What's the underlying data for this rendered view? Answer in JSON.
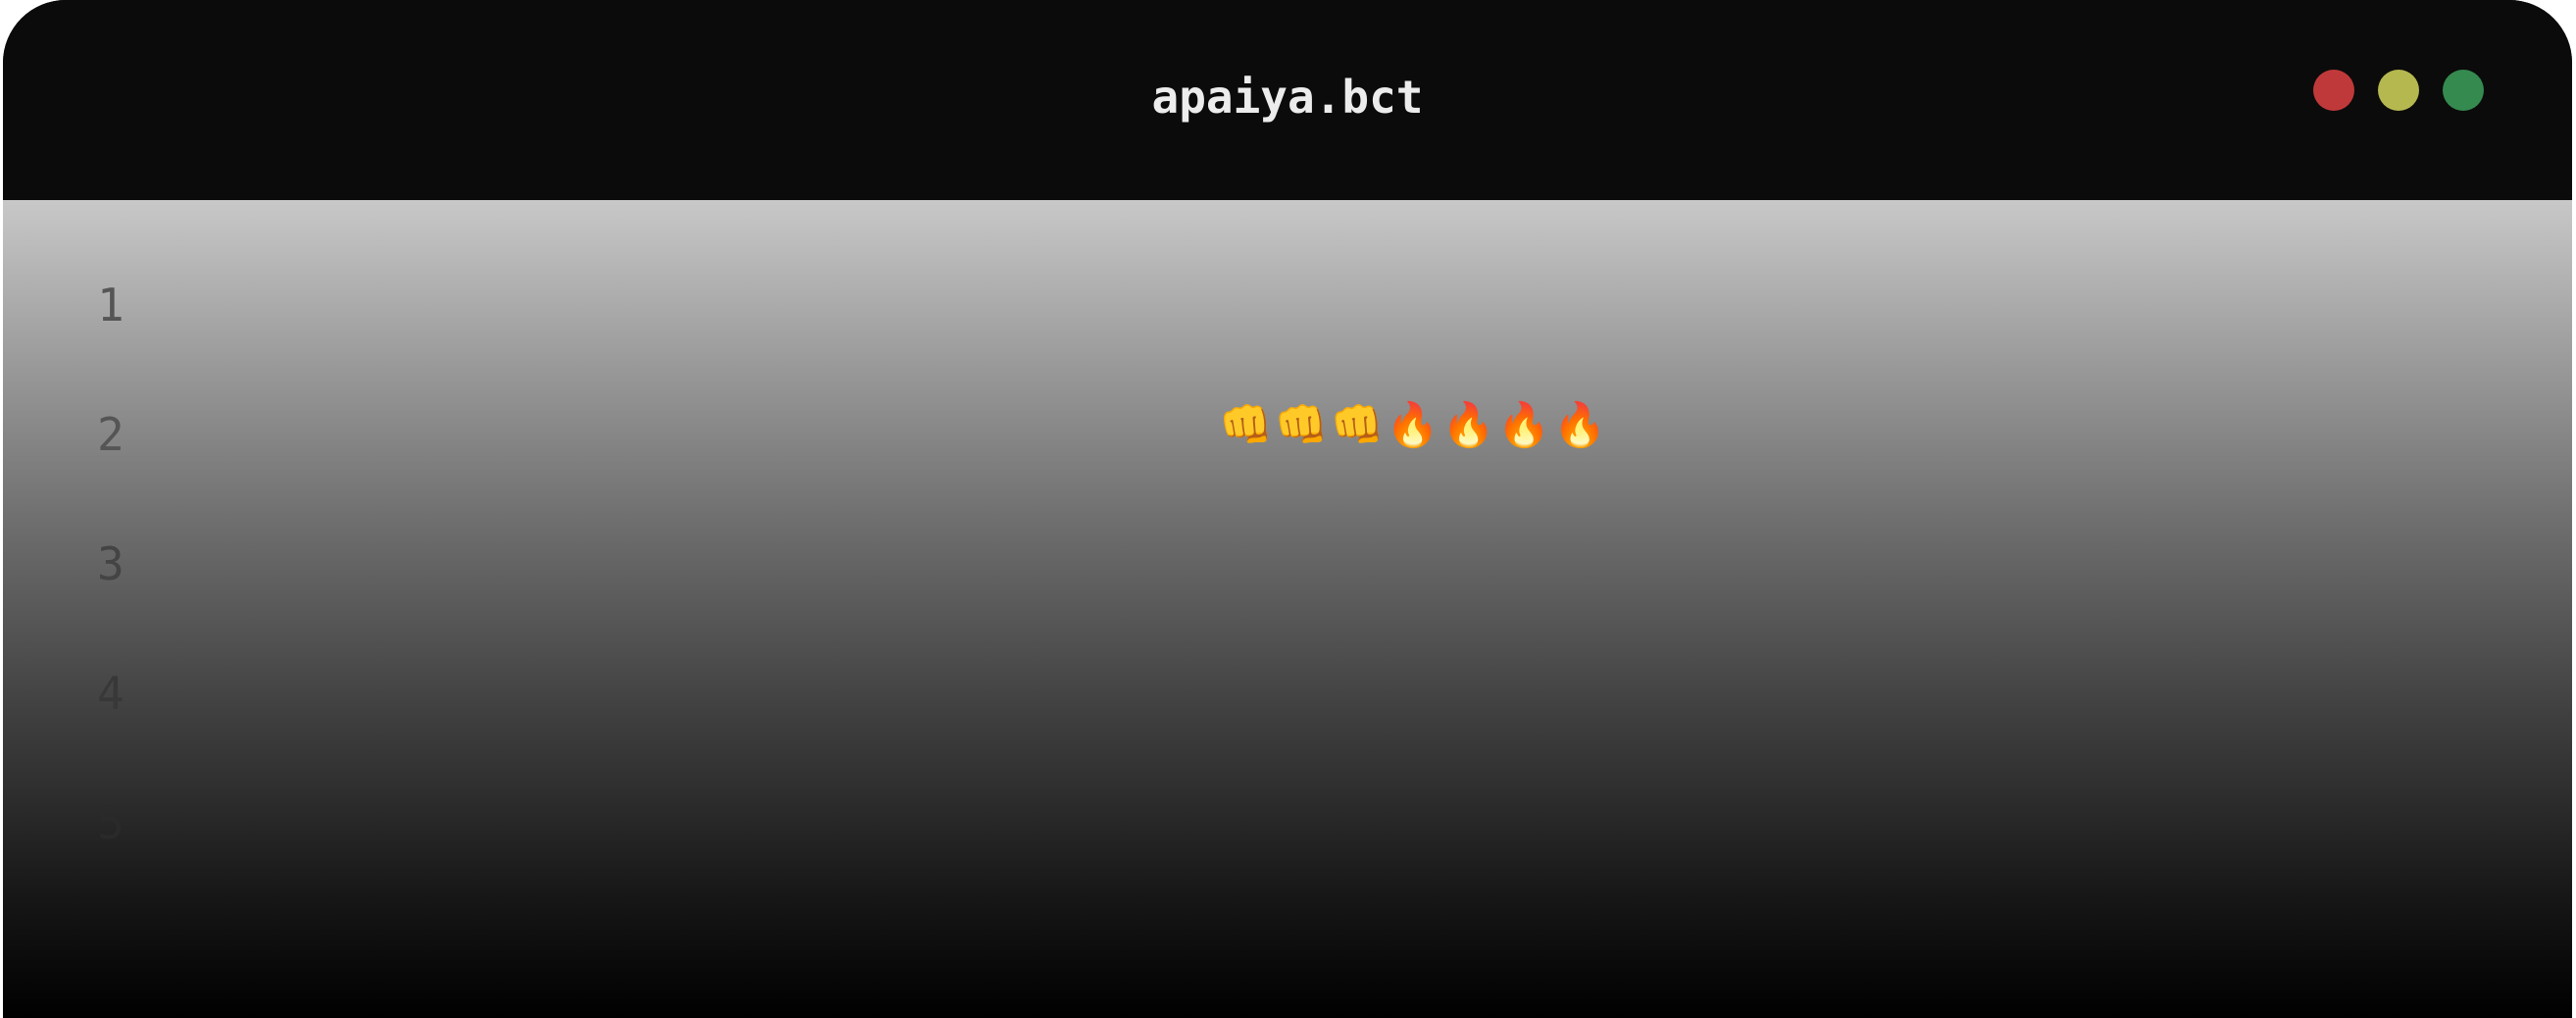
{
  "window": {
    "title": "apaiya.bct",
    "controls": [
      {
        "name": "close",
        "color": "#c0393a"
      },
      {
        "name": "minimize",
        "color": "#b5b84f"
      },
      {
        "name": "maximize",
        "color": "#358a4f"
      }
    ]
  },
  "editor": {
    "lines": [
      {
        "number": "1",
        "text": ""
      },
      {
        "number": "2",
        "text": "👊👊👊🔥🔥🔥🔥"
      },
      {
        "number": "3",
        "text": ""
      },
      {
        "number": "4",
        "text": ""
      },
      {
        "number": "5",
        "text": ""
      }
    ],
    "line_number_colors": [
      "#555555",
      "#555555",
      "#444444",
      "#383838",
      "#2a2a2a"
    ]
  }
}
